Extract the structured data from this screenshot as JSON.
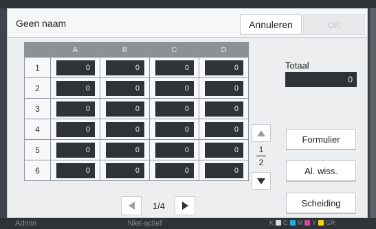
{
  "dialog": {
    "title": "Geen naam",
    "cancel_label": "Annuleren",
    "ok_label": "OK"
  },
  "grid": {
    "columns": [
      "A",
      "B",
      "C",
      "D"
    ],
    "rows": [
      {
        "label": "1",
        "values": [
          "0",
          "0",
          "0",
          "0"
        ]
      },
      {
        "label": "2",
        "values": [
          "0",
          "0",
          "0",
          "0"
        ]
      },
      {
        "label": "3",
        "values": [
          "0",
          "0",
          "0",
          "0"
        ]
      },
      {
        "label": "4",
        "values": [
          "0",
          "0",
          "0",
          "0"
        ]
      },
      {
        "label": "5",
        "values": [
          "0",
          "0",
          "0",
          "0"
        ]
      },
      {
        "label": "6",
        "values": [
          "0",
          "0",
          "0",
          "0"
        ]
      }
    ]
  },
  "vertical_pager": {
    "current": "1",
    "total": "2"
  },
  "horizontal_pager": {
    "label": "1/4"
  },
  "total": {
    "label": "Totaal",
    "value": "0"
  },
  "buttons": {
    "form_label": "Formulier",
    "clear_label": "Al. wiss.",
    "separation_label": "Scheiding"
  },
  "background": {
    "user": "Admin",
    "status": "Niet-actief",
    "toner_labels": [
      "K",
      "C",
      "M",
      "Y",
      "GR"
    ]
  },
  "colors": {
    "cell_bg": "#2e3338",
    "header_bg": "#8c9196",
    "dialog_bg": "#eceeef",
    "toner_c": "#2aa7df",
    "toner_m": "#e0409a",
    "toner_y": "#f2d21b",
    "toner_gr": "#a0a4a8"
  }
}
